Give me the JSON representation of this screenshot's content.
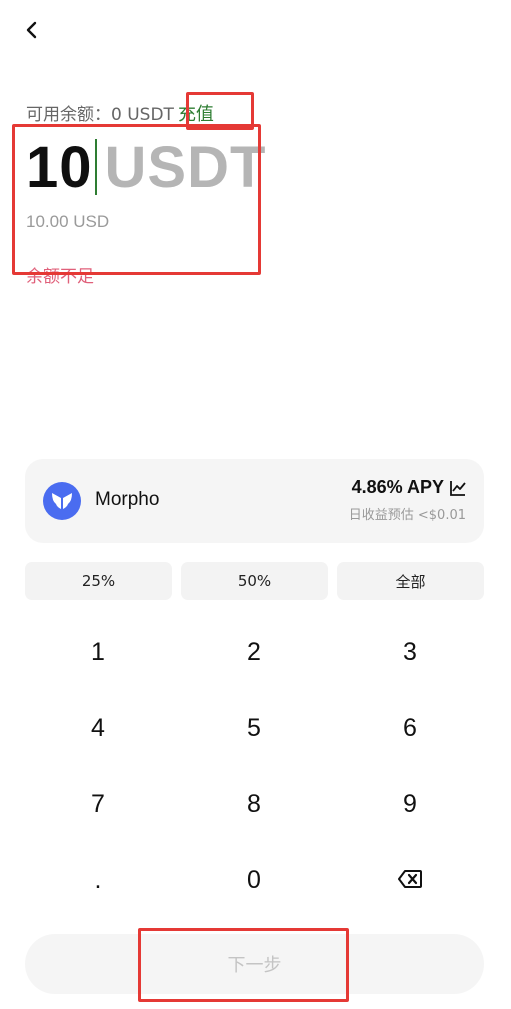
{
  "header": {
    "back_icon": "chevron-left-icon"
  },
  "balance": {
    "label": "可用余额：0 USDT",
    "topup_label": "充值"
  },
  "amount": {
    "value": "10",
    "unit": "USDT",
    "fiat_value": "10.00 USD",
    "error_text": "余额不足"
  },
  "protocol": {
    "name": "Morpho",
    "logo_icon": "morpho-butterfly-icon",
    "logo_color": "#4a6cf0",
    "apy": "4.86% APY",
    "apy_icon": "trend-chart-icon",
    "daily_estimate": "日收益预估 <$0.01"
  },
  "percent_buttons": [
    "25%",
    "50%",
    "全部"
  ],
  "keypad": {
    "keys": [
      "1",
      "2",
      "3",
      "4",
      "5",
      "6",
      "7",
      "8",
      "9",
      ".",
      "0"
    ],
    "backspace_icon": "backspace-icon"
  },
  "footer": {
    "next_label": "下一步"
  },
  "colors": {
    "accent_green": "#2e7d32",
    "error_pink": "#e0607a",
    "highlight_red": "#e53935"
  }
}
